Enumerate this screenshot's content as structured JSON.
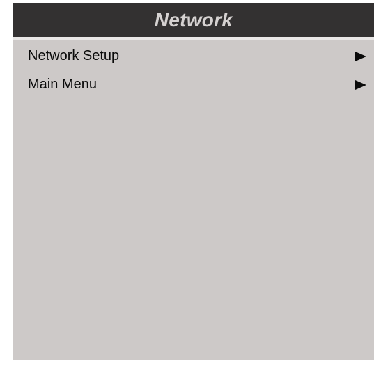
{
  "window": {
    "title": "Network"
  },
  "menu": {
    "items": [
      {
        "label": "Network Setup",
        "icon": "triangle-right-icon"
      },
      {
        "label": "Main Menu",
        "icon": "triangle-right-icon"
      }
    ]
  },
  "colors": {
    "title_bar_bg": "#333131",
    "title_text": "#d6d2d1",
    "panel_bg": "#cdc9c8",
    "item_text": "#0a0a0a"
  }
}
